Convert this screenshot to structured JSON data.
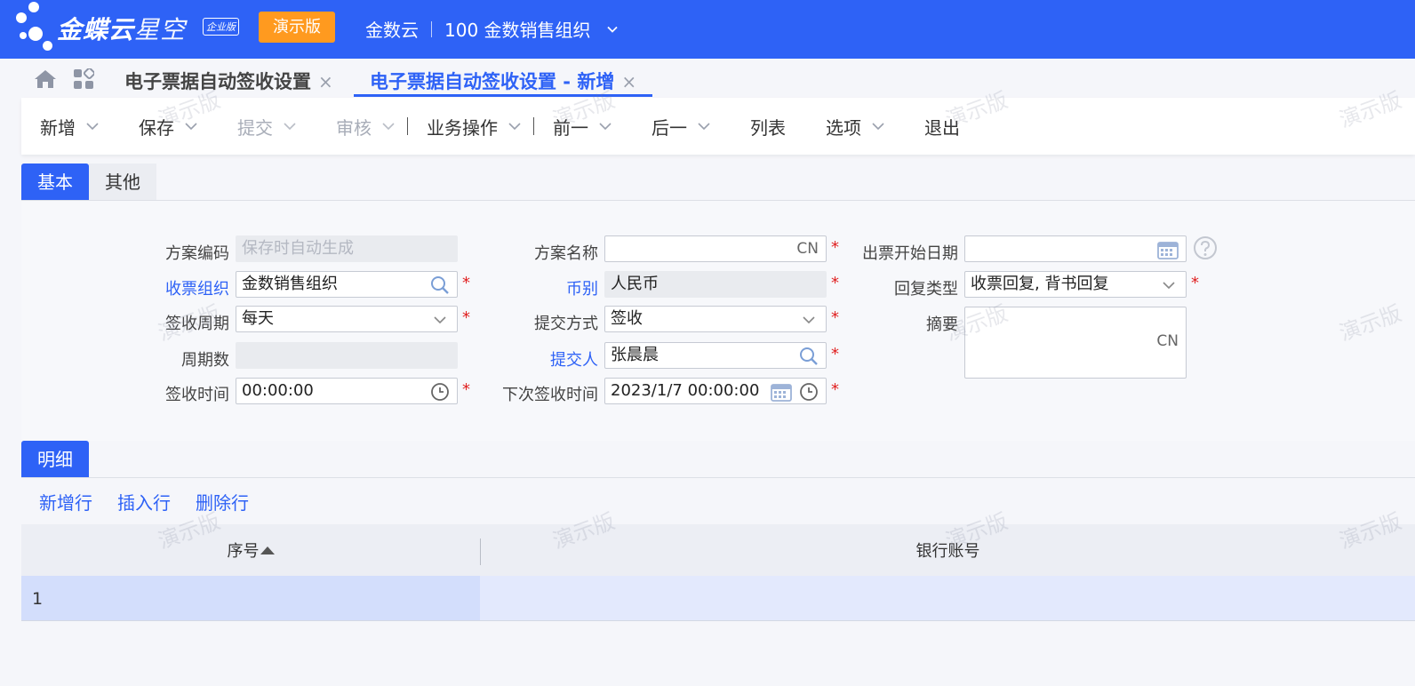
{
  "header": {
    "brand": "金蝶云",
    "brand_sub": "星空",
    "edition_badge": "企业版",
    "demo_label": "演示版",
    "cloud_name": "金数云",
    "org_name": "100 金数销售组织"
  },
  "tabs": [
    {
      "label": "电子票据自动签收设置",
      "close": "×"
    },
    {
      "label": "电子票据自动签收设置 - 新增",
      "close": "×"
    }
  ],
  "toolbar": {
    "new": "新增",
    "save": "保存",
    "submit": "提交",
    "audit": "审核",
    "business": "业务操作",
    "prev": "前一",
    "next": "后一",
    "list": "列表",
    "options": "选项",
    "exit": "退出"
  },
  "subtabs": {
    "basic": "基本",
    "other": "其他"
  },
  "form": {
    "scheme_code_label": "方案编码",
    "scheme_code_placeholder": "保存时自动生成",
    "scheme_name_label": "方案名称",
    "scheme_name_value": "",
    "lang_tag": "CN",
    "issue_start_label": "出票开始日期",
    "issue_start_value": "",
    "recv_org_label": "收票组织",
    "recv_org_value": "金数销售组织",
    "currency_label": "币别",
    "currency_value": "人民币",
    "reply_type_label": "回复类型",
    "reply_type_value": "收票回复, 背书回复",
    "cycle_label": "签收周期",
    "cycle_value": "每天",
    "submit_mode_label": "提交方式",
    "submit_mode_value": "签收",
    "summary_label": "摘要",
    "cycle_count_label": "周期数",
    "cycle_count_value": "",
    "submitter_label": "提交人",
    "submitter_value": "张晨晨",
    "sign_time_label": "签收时间",
    "sign_time_value": "00:00:00",
    "next_sign_label": "下次签收时间",
    "next_sign_value": "2023/1/7 00:00:00",
    "required_mark": "*"
  },
  "detail": {
    "tab_label": "明细",
    "actions": {
      "add_row": "新增行",
      "insert_row": "插入行",
      "delete_row": "删除行"
    },
    "columns": {
      "seq": "序号",
      "bank_account": "银行账号"
    },
    "rows": [
      {
        "seq": "1",
        "bank_account": ""
      }
    ]
  },
  "watermark_text": "演示版",
  "colors": {
    "primary": "#2e62f6",
    "demo_orange": "#ff9a1f",
    "required": "#e02020"
  }
}
